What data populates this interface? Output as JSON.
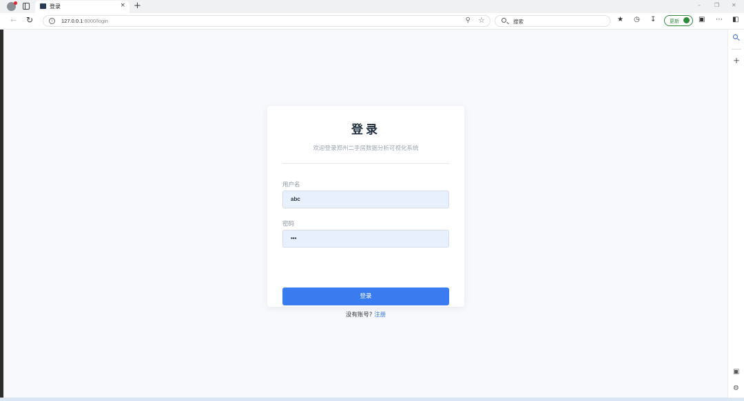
{
  "browser": {
    "tab_title": "登录",
    "tab_close": "×",
    "new_tab": "+",
    "url_host": "127.0.0.1",
    "url_rest": ":8000/login",
    "search_placeholder": "搜索",
    "update_label": "更新",
    "window_controls": [
      "–",
      "❐",
      "✕"
    ],
    "icons": [
      "profile-icon",
      "tab-actions-icon",
      "back-icon",
      "reload-icon",
      "info-icon",
      "key-icon",
      "star-icon",
      "search-icon",
      "favorites-icon",
      "history-icon",
      "download-icon",
      "screenshot-icon",
      "more-icon",
      "sidebar-icon",
      "plus-icon",
      "settings-icon"
    ]
  },
  "login": {
    "title": "登录",
    "subtitle": "欢迎登录郑州二手房数据分析可视化系统",
    "username_label": "用户名",
    "username_value": "abc",
    "password_label": "密码",
    "password_value": "•••",
    "submit_label": "登录",
    "register_prompt": "没有账号?",
    "register_link": "注册"
  },
  "colors": {
    "accent": "#3a7cf0",
    "input_bg": "#e8f0fe",
    "page_bg": "#f7f9fc"
  }
}
